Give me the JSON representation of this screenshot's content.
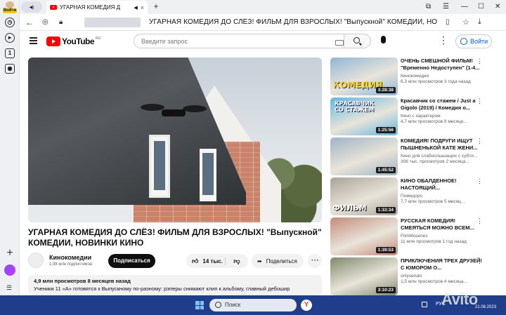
{
  "browser": {
    "profile_label": "Войти",
    "tab_title": "УГАРНАЯ КОМЕДИЯ Д",
    "page_title": "УГАРНАЯ КОМЕДИЯ ДО СЛЁЗ! ФИЛЬМ ДЛЯ ВЗРОСЛЫХ! \"Выпускной\" КОМЕДИИ, НОВИНКИ КИНО",
    "new_tab": "+",
    "tab_close": "×",
    "mute_glyph": "◀)"
  },
  "youtube": {
    "logo_text": "YouTube",
    "logo_region": "RU",
    "search_placeholder": "Введите запрос",
    "login_label": "Войти"
  },
  "video": {
    "title": "УГАРНАЯ КОМЕДИЯ ДО СЛЁЗ! ФИЛЬМ ДЛЯ ВЗРОСЛЫХ! \"Выпускной\" КОМЕДИИ, НОВИНКИ КИНО",
    "channel_name": "Кинокомедии",
    "channel_subs": "1,98 млн подписчиков",
    "subscribe_label": "Подписаться",
    "likes": "14 тыс.",
    "share_label": "Поделиться",
    "stats": "4,9 млн просмотров  8 месяцев назад",
    "description": "Ученики 11 «А» готовятся к Выпускному по-разному: рэперы снимают клип к альбому, главный дебошир"
  },
  "recommendations": [
    {
      "title": "ОЧЕНЬ СМЕШНОЙ ФИЛЬМ! \"Временно Недоступен\" (1-4...",
      "channel": "Кинокомедии",
      "meta": "6,3 млн просмотров  3 года назад",
      "duration": "3:28:38",
      "thumb_text": "КОМЕДИЯ",
      "thumb_color": "#8fb6d6"
    },
    {
      "title": "Красавчик со стажем / Just a Gigolo (2019) / Комедия о...",
      "channel": "Кино с характером",
      "meta": "4,7 млн просмотров  9 месяце...",
      "duration": "1:25:56",
      "thumb_text": "КРАСАВЧИК СО СТАЖЕМ",
      "thumb_color": "#62b7e0"
    },
    {
      "title": "КОМЕДИЯ! ПОДРУГИ ИЩУТ ПЫШНЕНЬКОЙ КАТЕ ЖЕНИ...",
      "channel": "Кино для слабослышащих с субти...",
      "meta": "306 тыс. просмотров  2 месяца...",
      "duration": "1:45:52",
      "thumb_text": "",
      "thumb_color": "#9fb3c4"
    },
    {
      "title": "КИНО ОБАЛДЕННОЕ! НАСТОЯЩИЙ...",
      "channel": "Помидоро",
      "meta": "7,7 млн просмотров  5 месяц...",
      "duration": "1:33:34",
      "thumb_text": "ФИЛЬМ",
      "thumb_color": "#a9a39a"
    },
    {
      "title": "РУССКАЯ КОМЕДИЯ! СМЕЯТЬСЯ МОЖНО ВСЕМ...",
      "channel": "FilmMoseries",
      "meta": "11 млн просмотров  1 год назад",
      "duration": "1:39:53",
      "thumb_text": "",
      "thumb_color": "#c58b7a"
    },
    {
      "title": "ПРИКЛЮЧЕНИЯ ТРЕХ ДРУЗЕЙ! С ЮМОРОМ О...",
      "channel": "onlyserials",
      "meta": "1,5 млн просмотров  4 месяца...",
      "duration": "3:10:23",
      "thumb_text": "",
      "thumb_color": "#7f8a6c"
    }
  ],
  "taskbar": {
    "search_label": "Поиск",
    "lang": "РУС",
    "date": "21.08.2023",
    "watermark": "Avito"
  }
}
